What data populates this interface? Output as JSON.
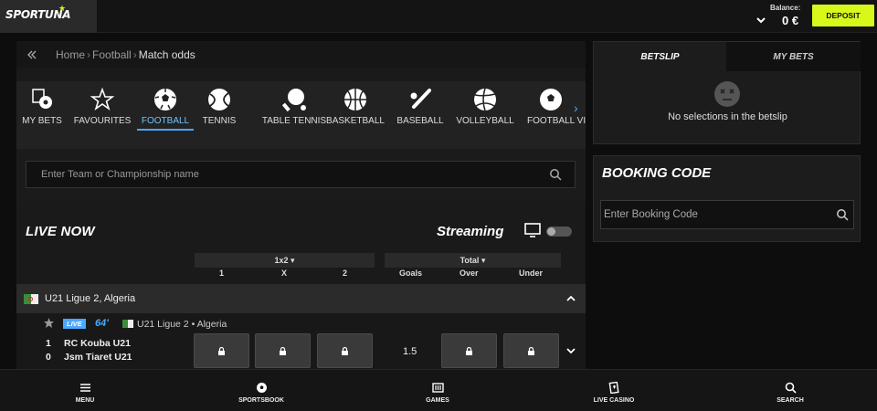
{
  "header": {
    "logo_text": "SPORTUNA",
    "balance_label": "Balance:",
    "balance_value": "0 €",
    "deposit_label": "DEPOSIT"
  },
  "breadcrumb": {
    "items": [
      "Home",
      "Football",
      "Match odds"
    ]
  },
  "categories": [
    {
      "label": "MY BETS",
      "icon": "my-bets-icon"
    },
    {
      "label": "FAVOURITES",
      "icon": "star-icon"
    },
    {
      "label": "FOOTBALL",
      "icon": "football-icon",
      "active": true
    },
    {
      "label": "TENNIS",
      "icon": "tennis-icon"
    },
    {
      "label": "TABLE TENNIS",
      "icon": "table-tennis-icon"
    },
    {
      "label": "BASKETBALL",
      "icon": "basketball-icon"
    },
    {
      "label": "BASEBALL",
      "icon": "baseball-icon"
    },
    {
      "label": "VOLLEYBALL",
      "icon": "volleyball-icon"
    },
    {
      "label": "FOOTBALL VI",
      "icon": "football-icon"
    }
  ],
  "search": {
    "placeholder": "Enter Team or Championship name"
  },
  "live": {
    "title": "LIVE NOW",
    "streaming_label": "Streaming",
    "market1_label": "1x2",
    "market2_label": "Total",
    "col_1": "1",
    "col_x": "X",
    "col_2": "2",
    "col_goals": "Goals",
    "col_over": "Over",
    "col_under": "Under"
  },
  "league": {
    "name": "U21 Ligue 2, Algeria"
  },
  "match": {
    "live_badge": "LIVE",
    "minute": "64'",
    "league_short": "U21 Ligue 2",
    "separator": "•",
    "country": "Algeria",
    "home_score": "1",
    "home_team": "RC Kouba U21",
    "away_score": "0",
    "away_team": "Jsm Tiaret U21",
    "goals_line": "1.5"
  },
  "betslip": {
    "tab_betslip": "BETSLIP",
    "tab_mybets": "MY BETS",
    "empty_text": "No selections in the betslip"
  },
  "booking": {
    "title": "BOOKING CODE",
    "placeholder": "Enter Booking Code"
  },
  "bottom_nav": [
    {
      "label": "MENU",
      "icon": "hamburger-icon"
    },
    {
      "label": "SPORTSBOOK",
      "icon": "football-icon"
    },
    {
      "label": "GAMES",
      "icon": "slot-machine-icon"
    },
    {
      "label": "LIVE CASINO",
      "icon": "cards-icon"
    },
    {
      "label": "SEARCH",
      "icon": "search-icon"
    }
  ],
  "colors": {
    "accent": "#d8f81c",
    "live_blue": "#4aa8ff"
  }
}
